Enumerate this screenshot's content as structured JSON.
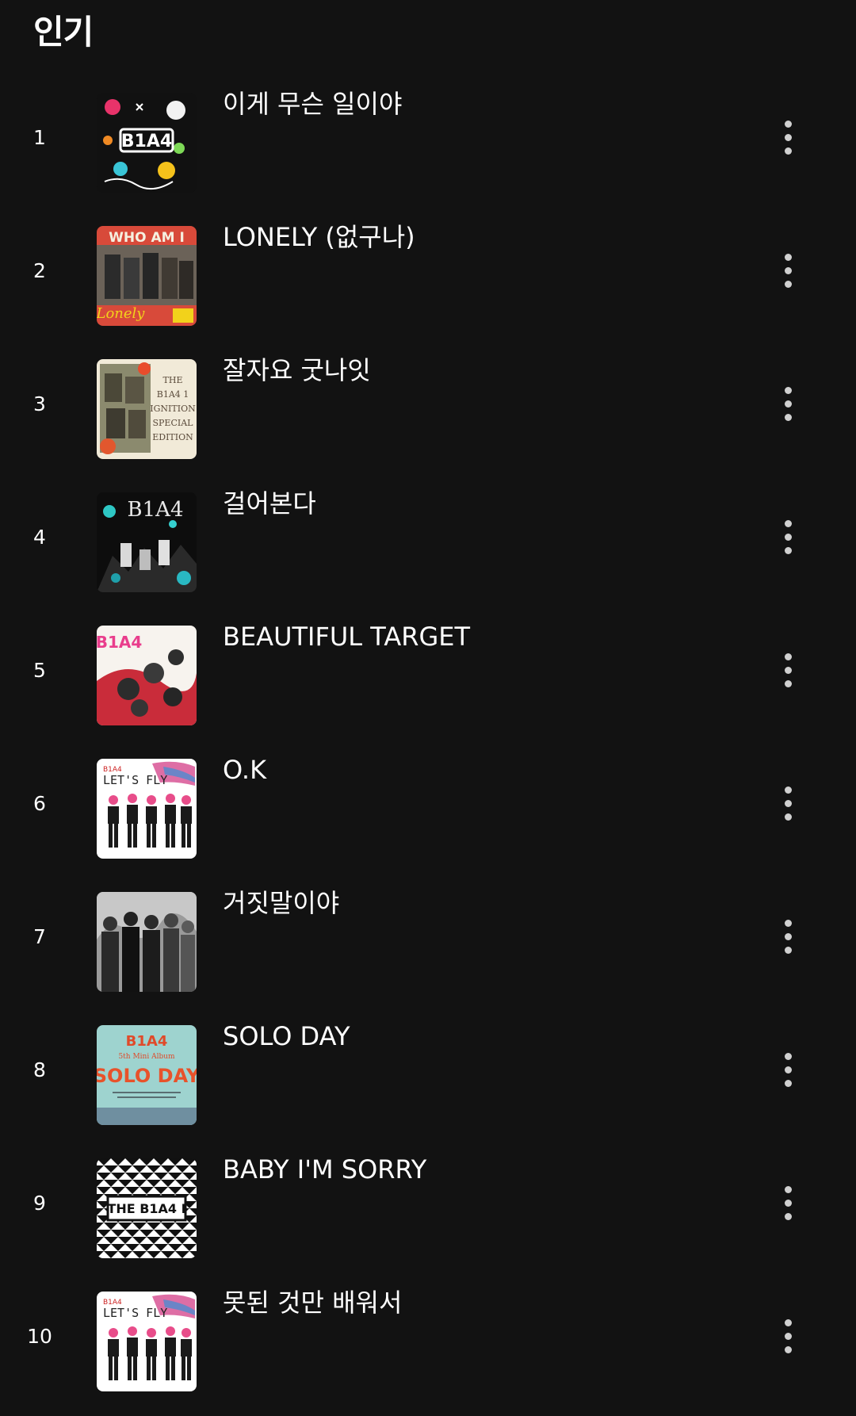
{
  "section": {
    "title": "인기"
  },
  "tracks": [
    {
      "rank": "1",
      "title": "이게 무슨 일이야",
      "art_icon": "album-art-b1a4-lets-fly-doodle"
    },
    {
      "rank": "2",
      "title": "LONELY (없구나)",
      "art_icon": "album-art-who-am-i"
    },
    {
      "rank": "3",
      "title": "잘자요 굿나잇",
      "art_icon": "album-art-ignition-special-edition"
    },
    {
      "rank": "4",
      "title": "걸어본다",
      "art_icon": "album-art-in-the-wind"
    },
    {
      "rank": "5",
      "title": "BEAUTIFUL TARGET",
      "art_icon": "album-art-its-b1a4"
    },
    {
      "rank": "6",
      "title": "O.K",
      "art_icon": "album-art-lets-fly"
    },
    {
      "rank": "7",
      "title": "거짓말이야",
      "art_icon": "album-art-monochrome-forest"
    },
    {
      "rank": "8",
      "title": "SOLO DAY",
      "art_icon": "album-art-solo-day"
    },
    {
      "rank": "9",
      "title": "BABY I'M SORRY",
      "art_icon": "album-art-the-b1a4-ignition"
    },
    {
      "rank": "10",
      "title": "못된 것만 배워서",
      "art_icon": "album-art-lets-fly"
    }
  ],
  "colors": {
    "background": "#121212",
    "text_primary": "#ffffff",
    "icon": "#d0d0d0"
  }
}
